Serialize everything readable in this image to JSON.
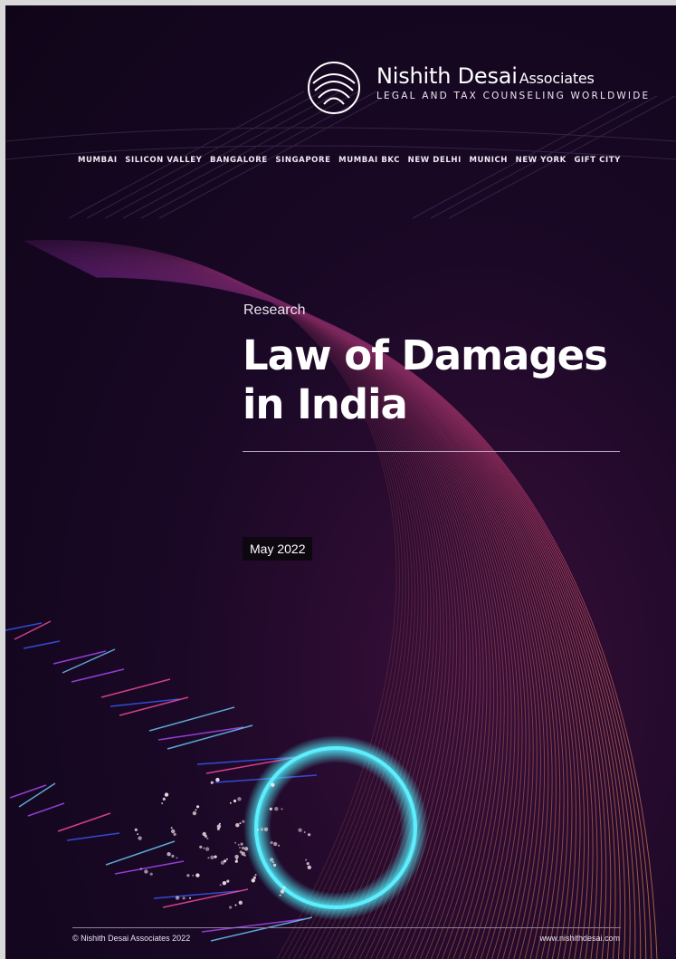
{
  "brand": {
    "name": "Nishith Desai",
    "associates": "Associates",
    "tagline": "LEGAL AND TAX COUNSELING WORLDWIDE"
  },
  "offices": [
    "MUMBAI",
    "SILICON VALLEY",
    "BANGALORE",
    "SINGAPORE",
    "MUMBAI BKC",
    "NEW DELHI",
    "MUNICH",
    "NEW YORK",
    "GIFT CITY"
  ],
  "cover": {
    "label": "Research",
    "title_line1": "Law of Damages",
    "title_line2": "in India",
    "date": "May 2022"
  },
  "footer": {
    "copyright": "© Nishith Desai Associates 2022",
    "website": "www.nishithdesai.com"
  },
  "colors": {
    "background": "#1a0826",
    "accent_ring": "#4fe3f0",
    "fiber_warm": "#c2406a"
  }
}
